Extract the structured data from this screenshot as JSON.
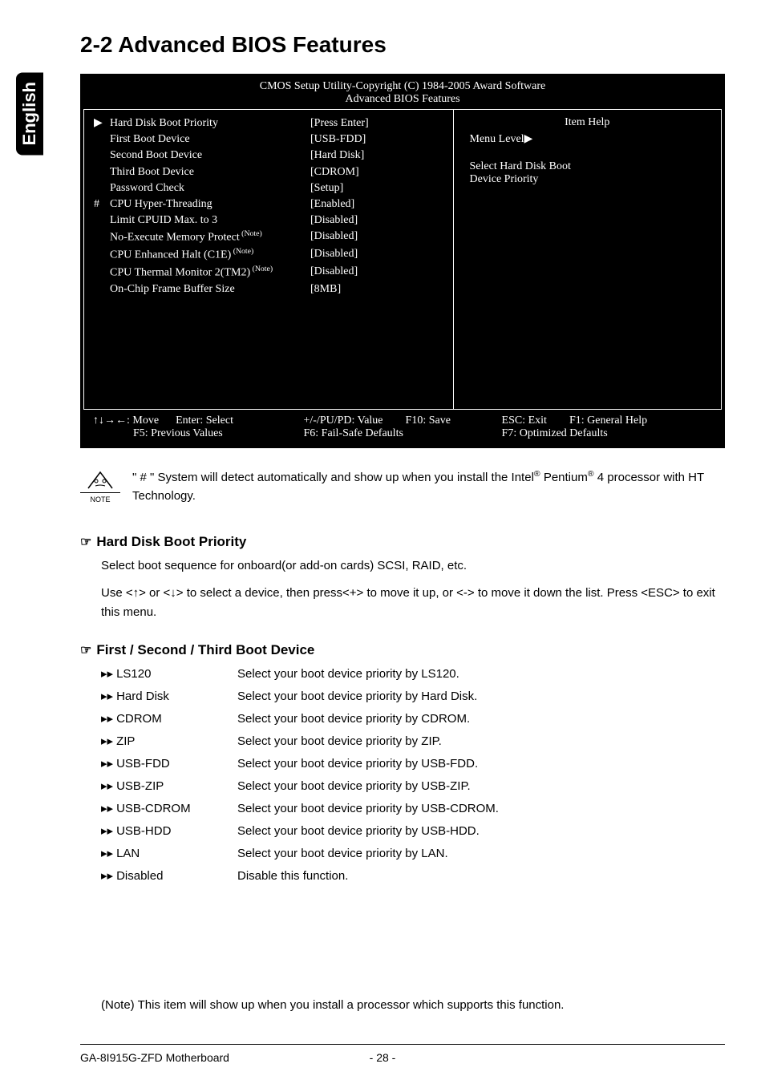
{
  "sideTab": "English",
  "pageTitle": "2-2   Advanced BIOS Features",
  "bios": {
    "headerLine1": "CMOS Setup Utility-Copyright (C) 1984-2005 Award Software",
    "headerLine2": "Advanced BIOS Features",
    "help": {
      "title": "Item Help",
      "menuLevel": "Menu Level",
      "desc1": "Select Hard Disk Boot",
      "desc2": "Device Priority"
    },
    "rows": [
      {
        "marker": "▶",
        "label": "Hard Disk Boot Priority",
        "value": "[Press Enter]"
      },
      {
        "marker": "",
        "label": "First Boot Device",
        "value": "[USB-FDD]"
      },
      {
        "marker": "",
        "label": "Second Boot Device",
        "value": "[Hard Disk]"
      },
      {
        "marker": "",
        "label": "Third Boot Device",
        "value": "[CDROM]"
      },
      {
        "marker": "",
        "label": "Password Check",
        "value": "[Setup]"
      },
      {
        "marker": "#",
        "label": "CPU Hyper-Threading",
        "value": "[Enabled]"
      },
      {
        "marker": "",
        "label": "Limit CPUID Max. to 3",
        "value": "[Disabled]"
      },
      {
        "marker": "",
        "label": "No-Execute Memory Protect",
        "note": "(Note)",
        "value": "[Disabled]"
      },
      {
        "marker": "",
        "label": "CPU Enhanced Halt (C1E)",
        "note": "(Note)",
        "value": "[Disabled]"
      },
      {
        "marker": "",
        "label": "CPU Thermal Monitor 2(TM2)",
        "note": "(Note)",
        "value": "[Disabled]"
      },
      {
        "marker": "",
        "label": "On-Chip Frame Buffer Size",
        "value": "[8MB]"
      }
    ],
    "footer": {
      "g1a": "↑↓→←: Move",
      "g1b": "Enter: Select",
      "g1c": "F5: Previous Values",
      "g2a": "+/-/PU/PD: Value",
      "g2b": "F10: Save",
      "g2c": "F6: Fail-Safe Defaults",
      "g3a": "ESC: Exit",
      "g3b": "F1: General Help",
      "g3c": "F7: Optimized Defaults"
    }
  },
  "noteLabel": "NOTE",
  "noteText1": "\" # \" System will detect automatically and show up when you install the Intel",
  "noteText2": " Pentium",
  "noteText3": " 4 processor with HT Technology.",
  "reg": "®",
  "sections": [
    {
      "heading": "Hard Disk Boot Priority",
      "paragraphs": [
        "Select boot sequence for onboard(or add-on cards) SCSI, RAID, etc.",
        "Use <↑> or <↓> to select a device, then press<+> to move it up, or <-> to move it down the list. Press <ESC> to exit this menu."
      ]
    },
    {
      "heading": "First / Second / Third Boot Device",
      "options": [
        {
          "name": "LS120",
          "desc": "Select your boot device priority by LS120."
        },
        {
          "name": "Hard Disk",
          "desc": "Select your boot device priority by Hard Disk."
        },
        {
          "name": "CDROM",
          "desc": "Select your boot device priority by CDROM."
        },
        {
          "name": "ZIP",
          "desc": "Select your boot device priority by ZIP."
        },
        {
          "name": "USB-FDD",
          "desc": "Select your boot device priority by USB-FDD."
        },
        {
          "name": "USB-ZIP",
          "desc": "Select your boot device priority by USB-ZIP."
        },
        {
          "name": "USB-CDROM",
          "desc": "Select your boot device priority by USB-CDROM."
        },
        {
          "name": "USB-HDD",
          "desc": "Select your boot device priority by USB-HDD."
        },
        {
          "name": "LAN",
          "desc": "Select your boot device priority by LAN."
        },
        {
          "name": "Disabled",
          "desc": "Disable this function."
        }
      ]
    }
  ],
  "footnote": "(Note)   This item will show up when you install a processor which supports this function.",
  "pageFooter": {
    "left": "GA-8I915G-ZFD Motherboard",
    "center": "- 28 -"
  }
}
